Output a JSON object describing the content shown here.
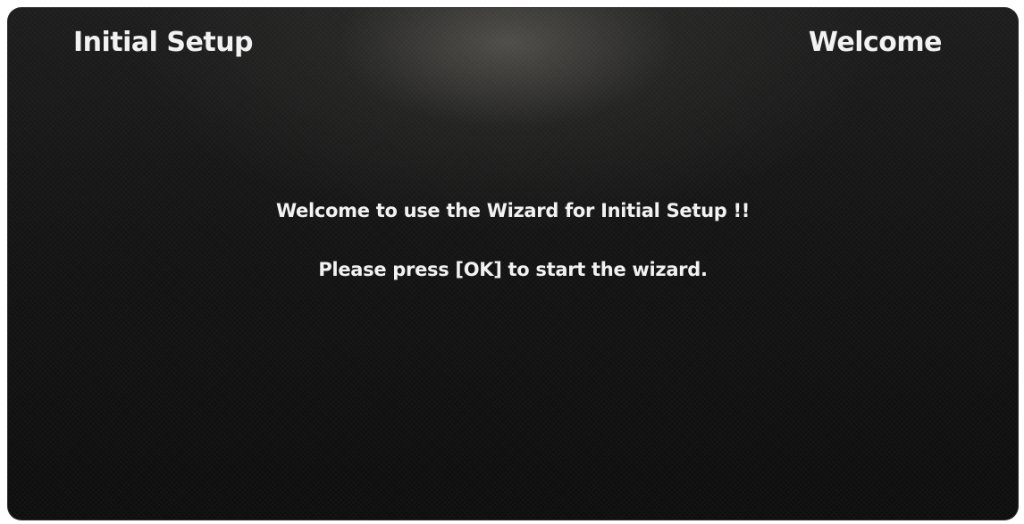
{
  "header": {
    "title": "Initial Setup",
    "step": "Welcome"
  },
  "body": {
    "welcome_message": "Welcome to use the Wizard for Initial Setup !!",
    "instruction": "Please press [OK] to start the wizard."
  },
  "colors": {
    "background": "#121212",
    "text": "#f2f2f2"
  }
}
